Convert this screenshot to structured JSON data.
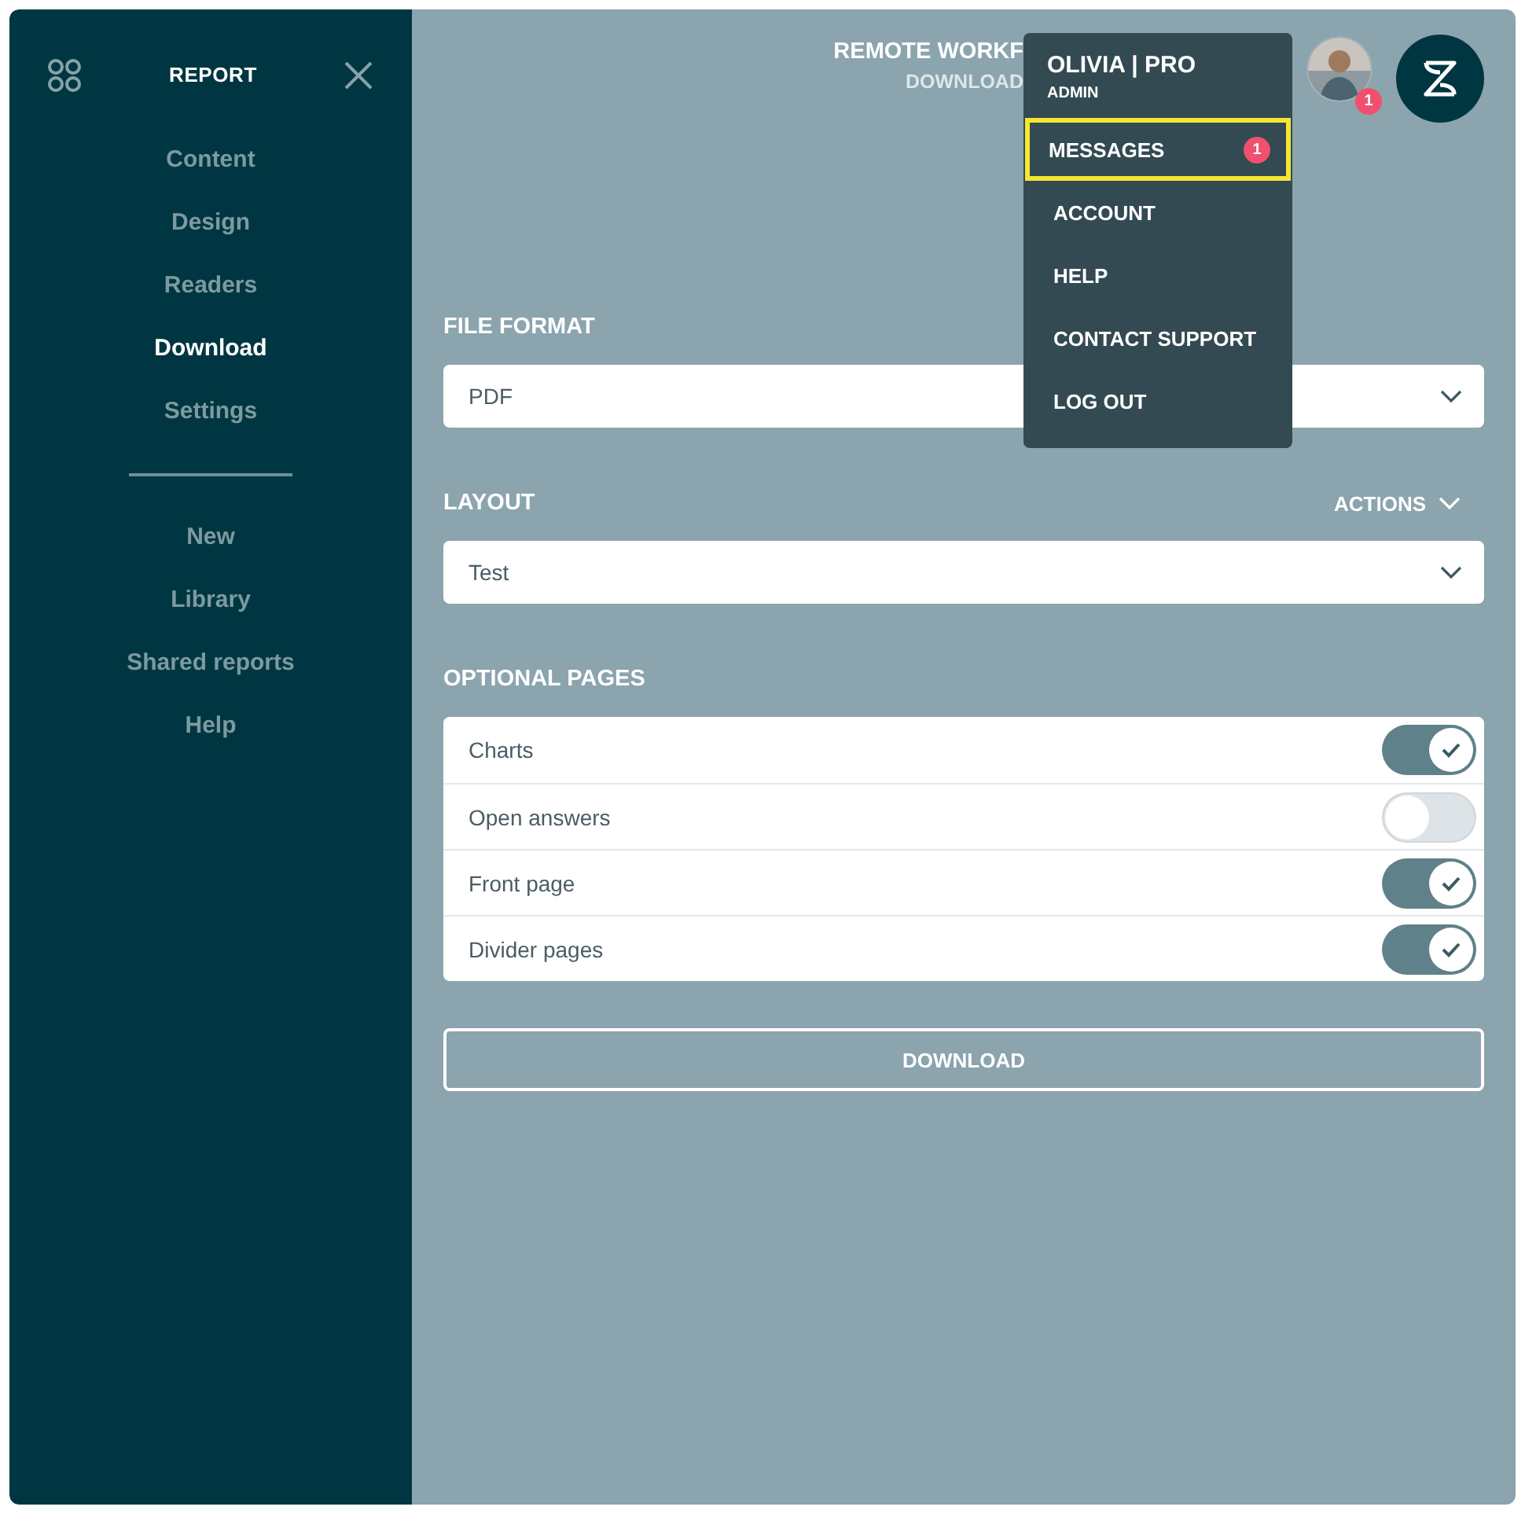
{
  "sidebar": {
    "title": "REPORT",
    "items": [
      {
        "label": "Content",
        "selected": false
      },
      {
        "label": "Design",
        "selected": false
      },
      {
        "label": "Readers",
        "selected": false
      },
      {
        "label": "Download",
        "selected": true
      },
      {
        "label": "Settings",
        "selected": false
      }
    ],
    "secondary_items": [
      {
        "label": "New",
        "selected": false
      },
      {
        "label": "Library",
        "selected": false
      },
      {
        "label": "Shared reports",
        "selected": false
      },
      {
        "label": "Help",
        "selected": false
      }
    ]
  },
  "header": {
    "title": "REMOTE WORKF",
    "subtitle": "DOWNLOAD",
    "avatar_badge": "1"
  },
  "user_menu": {
    "name": "OLIVIA | PRO",
    "role": "ADMIN",
    "items": [
      {
        "label": "MESSAGES",
        "badge": "1",
        "highlighted": true
      },
      {
        "label": "ACCOUNT",
        "highlighted": false
      },
      {
        "label": "HELP",
        "highlighted": false
      },
      {
        "label": "CONTACT SUPPORT",
        "highlighted": false
      },
      {
        "label": "LOG OUT",
        "highlighted": false
      }
    ]
  },
  "file_format": {
    "label": "FILE FORMAT",
    "value": "PDF"
  },
  "layout": {
    "label": "LAYOUT",
    "actions": "ACTIONS",
    "value": "Test"
  },
  "optional_pages": {
    "label": "OPTIONAL PAGES",
    "items": [
      {
        "label": "Charts",
        "on": true
      },
      {
        "label": "Open answers",
        "on": false
      },
      {
        "label": "Front page",
        "on": true
      },
      {
        "label": "Divider pages",
        "on": true
      }
    ]
  },
  "download_button": "DOWNLOAD"
}
